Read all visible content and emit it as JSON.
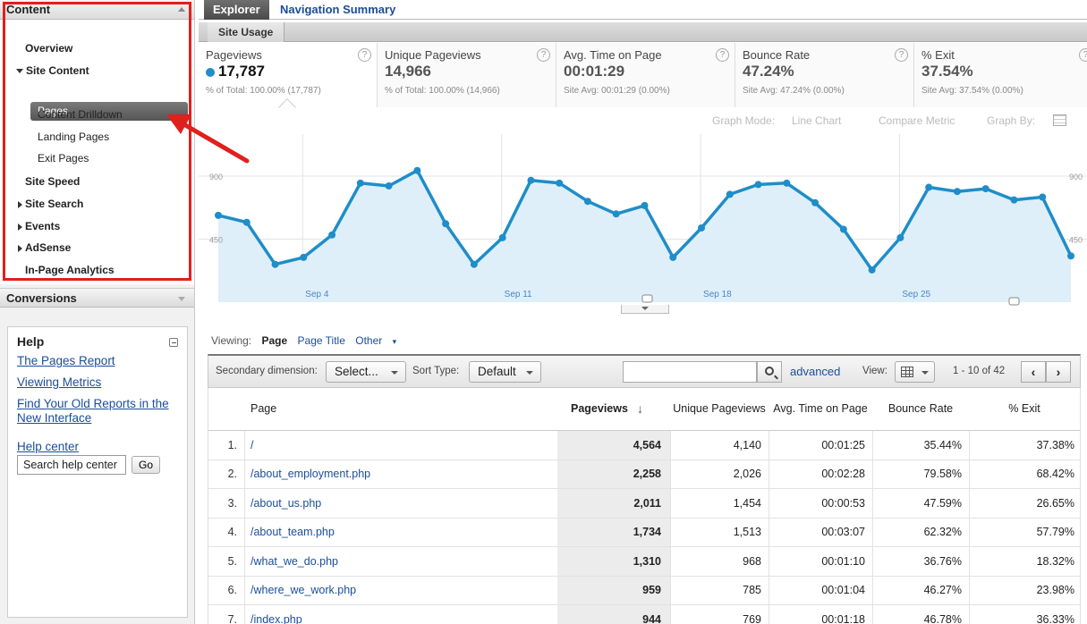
{
  "sidebar": {
    "content_header": "Content",
    "nav": {
      "overview": "Overview",
      "site_content": "Site Content",
      "pages": "Pages",
      "content_drilldown": "Content Drilldown",
      "landing_pages": "Landing Pages",
      "exit_pages": "Exit Pages",
      "site_speed": "Site Speed",
      "site_search": "Site Search",
      "events": "Events",
      "adsense": "AdSense",
      "in_page_analytics": "In-Page Analytics"
    },
    "conversions_header": "Conversions",
    "help": {
      "title": "Help",
      "links": [
        "The Pages Report",
        "Viewing Metrics",
        "Find Your Old Reports in the New Interface"
      ],
      "help_center": "Help center",
      "search_value": "Search help center",
      "go": "Go"
    }
  },
  "tabs": {
    "explorer": "Explorer",
    "navigation_summary": "Navigation Summary",
    "site_usage": "Site Usage"
  },
  "metrics": [
    {
      "label": "Pageviews",
      "value": "17,787",
      "sub": "% of Total: 100.00% (17,787)"
    },
    {
      "label": "Unique Pageviews",
      "value": "14,966",
      "sub": "% of Total: 100.00% (14,966)"
    },
    {
      "label": "Avg. Time on Page",
      "value": "00:01:29",
      "sub": "Site Avg: 00:01:29 (0.00%)"
    },
    {
      "label": "Bounce Rate",
      "value": "47.24%",
      "sub": "Site Avg: 47.24% (0.00%)"
    },
    {
      "label": "% Exit",
      "value": "37.54%",
      "sub": "Site Avg: 37.54% (0.00%)"
    }
  ],
  "graph_options": {
    "graph_mode": "Graph Mode:",
    "line_chart": "Line Chart",
    "compare_metric": "Compare Metric",
    "graph_by": "Graph By:"
  },
  "chart_data": {
    "type": "area",
    "x_ticks": [
      "Sep 4",
      "Sep 11",
      "Sep 18",
      "Sep 25"
    ],
    "y_ticks": [
      "900",
      "450"
    ],
    "ylim": [
      0,
      1200
    ],
    "series": [
      {
        "values": [
          620,
          570,
          270,
          320,
          480,
          850,
          830,
          940,
          560,
          270,
          460,
          870,
          850,
          720,
          630,
          690,
          320,
          530,
          770,
          840,
          850,
          710,
          520,
          230,
          460,
          820,
          790,
          810,
          730,
          750,
          330
        ]
      }
    ],
    "colors": {
      "line": "#1f8dc8",
      "fill": "#deeff9"
    }
  },
  "viewing": {
    "label": "Viewing:",
    "page": "Page",
    "page_title": "Page Title",
    "other": "Other"
  },
  "toolbar": {
    "secondary_dimension": "Secondary dimension:",
    "select": "Select...",
    "sort_type": "Sort Type:",
    "default": "Default",
    "advanced": "advanced",
    "view": "View:",
    "range": "1 - 10 of 42",
    "prev": "‹",
    "next": "›"
  },
  "table": {
    "headers": {
      "page": "Page",
      "pageviews": "Pageviews",
      "unique": "Unique Pageviews",
      "avg_time": "Avg. Time on Page",
      "bounce": "Bounce Rate",
      "exit": "% Exit"
    },
    "rows": [
      {
        "n": "1.",
        "page": "/",
        "pv": "4,564",
        "upv": "4,140",
        "time": "00:01:25",
        "bounce": "35.44%",
        "exit": "37.38%"
      },
      {
        "n": "2.",
        "page": "/about_employment.php",
        "pv": "2,258",
        "upv": "2,026",
        "time": "00:02:28",
        "bounce": "79.58%",
        "exit": "68.42%"
      },
      {
        "n": "3.",
        "page": "/about_us.php",
        "pv": "2,011",
        "upv": "1,454",
        "time": "00:00:53",
        "bounce": "47.59%",
        "exit": "26.65%"
      },
      {
        "n": "4.",
        "page": "/about_team.php",
        "pv": "1,734",
        "upv": "1,513",
        "time": "00:03:07",
        "bounce": "62.32%",
        "exit": "57.79%"
      },
      {
        "n": "5.",
        "page": "/what_we_do.php",
        "pv": "1,310",
        "upv": "968",
        "time": "00:01:10",
        "bounce": "36.76%",
        "exit": "18.32%"
      },
      {
        "n": "6.",
        "page": "/where_we_work.php",
        "pv": "959",
        "upv": "785",
        "time": "00:01:04",
        "bounce": "46.27%",
        "exit": "23.98%"
      },
      {
        "n": "7.",
        "page": "/index.php",
        "pv": "944",
        "upv": "769",
        "time": "00:01:18",
        "bounce": "46.78%",
        "exit": "36.33%"
      }
    ]
  }
}
